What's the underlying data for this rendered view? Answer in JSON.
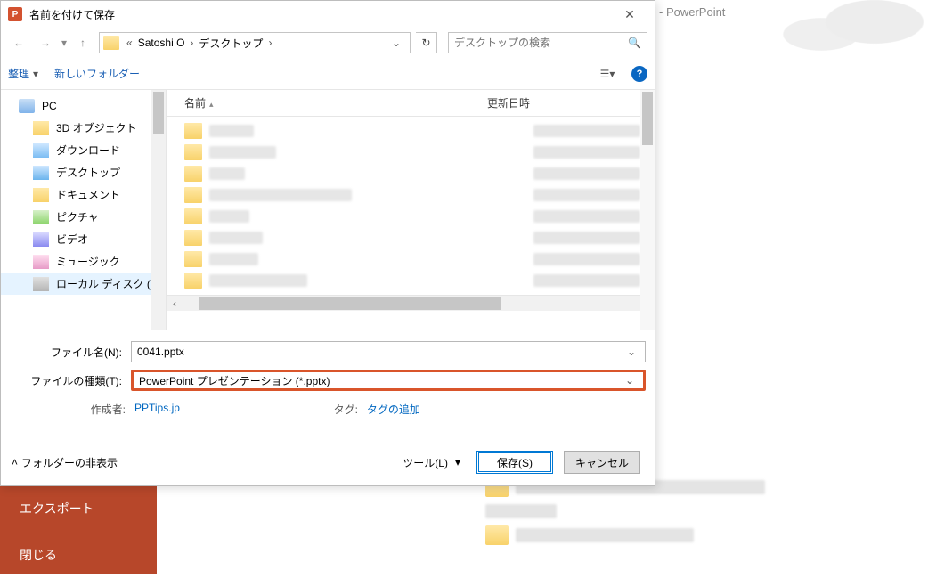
{
  "bg": {
    "app_title": "- PowerPoint",
    "sidebar": {
      "export": "エクスポート",
      "close": "閉じる"
    }
  },
  "dialog": {
    "title": "名前を付けて保存",
    "breadcrumb": {
      "prefix": "«",
      "user": "Satoshi O",
      "location": "デスクトップ"
    },
    "search_placeholder": "デスクトップの検索",
    "toolbar": {
      "organize": "整理",
      "new_folder": "新しいフォルダー"
    },
    "tree": {
      "pc": "PC",
      "items": [
        "3D オブジェクト",
        "ダウンロード",
        "デスクトップ",
        "ドキュメント",
        "ピクチャ",
        "ビデオ",
        "ミュージック",
        "ローカル ディスク (C"
      ]
    },
    "columns": {
      "name": "名前",
      "date": "更新日時"
    },
    "filename_label": "ファイル名(N):",
    "filename_value": "0041.pptx",
    "filetype_label": "ファイルの種類(T):",
    "filetype_value": "PowerPoint プレゼンテーション (*.pptx)",
    "author_label": "作成者:",
    "author_value": "PPTips.jp",
    "tag_label": "タグ:",
    "tag_value": "タグの追加",
    "hide_folders": "フォルダーの非表示",
    "tools": "ツール(L)",
    "save": "保存(S)",
    "cancel": "キャンセル"
  }
}
